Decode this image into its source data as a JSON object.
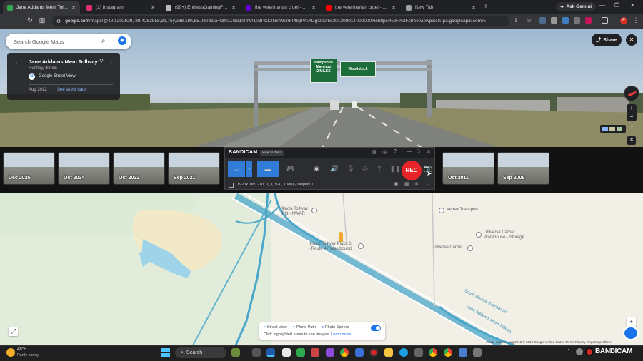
{
  "browser": {
    "tabs": [
      {
        "title": "Jane Addams Mem Tollway - G",
        "color": "#34a853",
        "active": true
      },
      {
        "title": "(2) Instagram",
        "color": "#e1306c",
        "active": false
      },
      {
        "title": "(99+) EndlessGamingFanProdu",
        "color": "#bbbbbb",
        "active": false
      },
      {
        "title": "the veterinarian cruel - Yahoo S",
        "color": "#6001d2",
        "active": false
      },
      {
        "title": "the veterinarian cruel - YouTub",
        "color": "#ff0000",
        "active": false
      },
      {
        "title": "New Tab",
        "color": "#9aa0a6",
        "active": false
      }
    ],
    "ask_gemini": "Ask Gemini",
    "url_domain": "google.com",
    "url_path": "/maps/@42.1202629,-88.4282958,3a,75y,288.19h,85.08t/data=!3m11!1e1!3m9!1sBPCLzNxtW0nFPflq8VAXDg!2e0!5s20120801T000000!6shttps:%2F%2Fstreetviewpixels-pa.googleapis.com%",
    "avatar_letter": "E"
  },
  "street_view": {
    "search_placeholder": "Search Google Maps",
    "place_title": "Jane Addams Mem Tollway",
    "place_subtitle": "Huntley, Illinois",
    "source": "Google Street View",
    "date": "Aug 2012",
    "see_latest": "See latest date",
    "share_label": "Share",
    "sign_left": "Hampshire\nMarengo\n2 MILES",
    "sign_right": "Woodstock"
  },
  "timeline": {
    "thumbs": [
      "Dec 2025",
      "Oct 2024",
      "Oct 2022",
      "Sep 2021",
      "Oct 2011",
      "Sep 2008"
    ]
  },
  "bandicam": {
    "brand": "BANDICAM",
    "edition": "PERSONAL",
    "rec_label": "REC",
    "display_info": "1920x1080 - (0, 0), (1920, 1080) - Display 1"
  },
  "map": {
    "poi_tollway": "Illinois Tollway\nIPO - NWAR",
    "poi_plaza": "Illinois Tollway Plaza 6\n- Route 47 Westbound",
    "poi_vertex": "Vertex Transport",
    "poi_universal_warehouse": "Universe Carrier\nWarehouse - Storage",
    "poi_universe_carrier": "Universe Carrier",
    "road_label": "Jane Addams Mem Tollway",
    "road_label2": "South Bonnie Kotcher Dr",
    "legend_street_view": "Street View",
    "legend_photo_path": "Photo Path",
    "legend_photo_sphere": "Photo Sphere",
    "legend_hint": "Click highlighted areas to see images.",
    "legend_learn_more": "Learn more",
    "attribution": "Image capture: Aug 2012   © 2026 Google   United States   Terms   Privacy   Report a problem"
  },
  "taskbar": {
    "weather_temp": "48°F",
    "weather_desc": "Partly sunny",
    "search_label": "Search",
    "tray_brand": "BANDICAM"
  }
}
